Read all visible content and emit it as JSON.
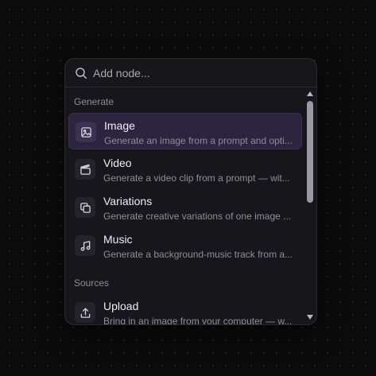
{
  "search": {
    "placeholder": "Add node..."
  },
  "sections": [
    {
      "label": "Generate",
      "items": [
        {
          "title": "Image",
          "description": "Generate an image from a prompt and opti...",
          "icon": "image-icon",
          "selected": true
        },
        {
          "title": "Video",
          "description": "Generate a video clip from a prompt — wit...",
          "icon": "video-icon",
          "selected": false
        },
        {
          "title": "Variations",
          "description": "Generate creative variations of one image ...",
          "icon": "copy-icon",
          "selected": false
        },
        {
          "title": "Music",
          "description": "Generate a background-music track from a...",
          "icon": "music-icon",
          "selected": false
        }
      ]
    },
    {
      "label": "Sources",
      "items": [
        {
          "title": "Upload",
          "description": "Bring in an image from your computer — w...",
          "icon": "upload-icon",
          "selected": false
        }
      ]
    }
  ],
  "colors": {
    "background": "#0b0b0c",
    "panel": "#17161b",
    "selected": "#2d2540"
  }
}
